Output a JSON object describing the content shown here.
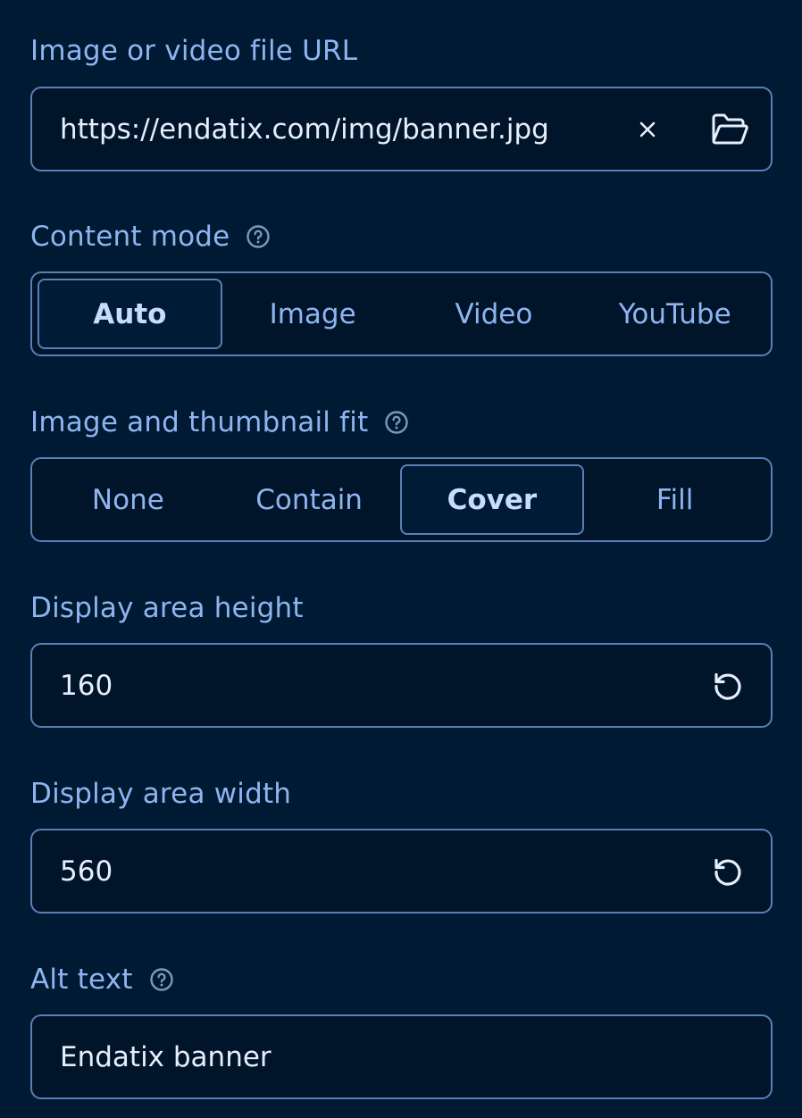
{
  "url_field": {
    "label": "Image or video file URL",
    "value": "https://endatix.com/img/banner.jpg",
    "clear_glyph": "×",
    "icons": [
      "close-icon",
      "folder-open-icon"
    ]
  },
  "content_mode": {
    "label": "Content mode",
    "icon": "help-circle-icon",
    "options": [
      "Auto",
      "Image",
      "Video",
      "YouTube"
    ],
    "selected": "Auto"
  },
  "fit": {
    "label": "Image and thumbnail fit",
    "icon": "help-circle-icon",
    "options": [
      "None",
      "Contain",
      "Cover",
      "Fill"
    ],
    "selected": "Cover"
  },
  "height_field": {
    "label": "Display area height",
    "value": "160",
    "icon": "reset-icon"
  },
  "width_field": {
    "label": "Display area width",
    "value": "560",
    "icon": "reset-icon"
  },
  "alt_text": {
    "label": "Alt text",
    "icon": "help-circle-icon",
    "value": "Endatix banner"
  },
  "colors": {
    "background": "#001a33",
    "field_background": "#00142a",
    "border": "#5a7fb8",
    "label": "#8fb5f0",
    "text": "#e6eefb"
  }
}
